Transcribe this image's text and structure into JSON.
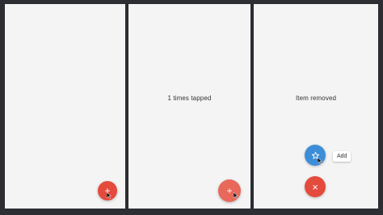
{
  "panels": [
    {
      "status_text": "",
      "fab": {
        "glyph": "+",
        "icon": "plus-icon",
        "color": "#e44b3c"
      }
    },
    {
      "status_text": "1 times tapped",
      "fab": {
        "glyph": "+",
        "icon": "plus-icon",
        "color": "#e8685a"
      }
    },
    {
      "status_text": "Item removed",
      "fab": {
        "glyph": "×",
        "icon": "close-icon",
        "color": "#e44b3c"
      },
      "mini_fab": {
        "icon": "star-outline-icon",
        "color": "#3d8ed9"
      },
      "mini_fab_label": "Add"
    }
  ]
}
